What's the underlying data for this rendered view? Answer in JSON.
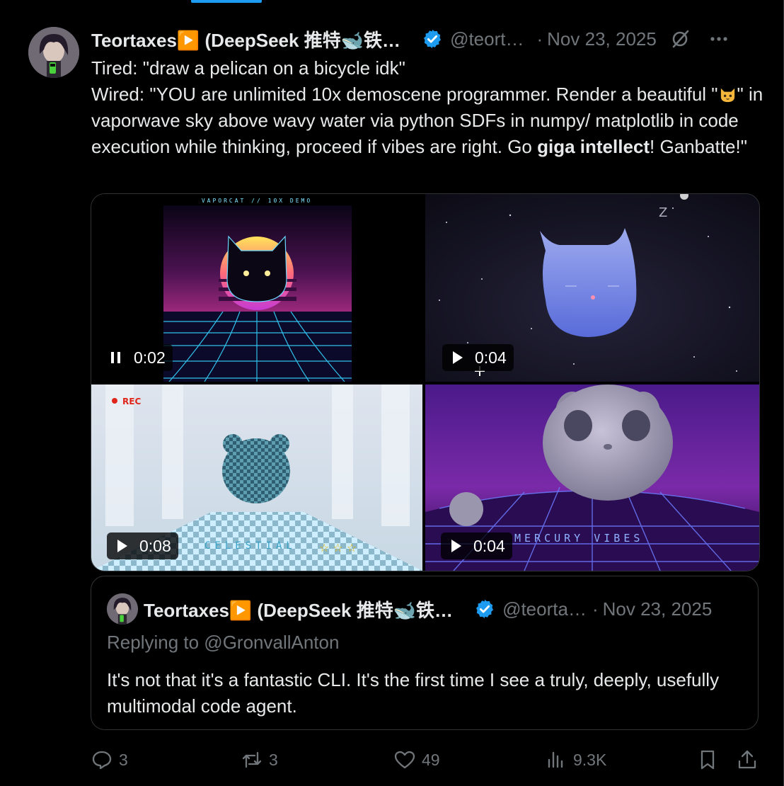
{
  "tweet": {
    "author_name": "Teortaxes▶️ (DeepSeek 推特🐋铁…",
    "handle": "@teort…",
    "separator": "·",
    "date": "Nov 23, 2025",
    "lines": {
      "tired": "Tired: \"draw a pelican on a bicycle idk\"",
      "wired_1": "Wired: \"YOU are unlimited 10x demoscene programmer. Render a beautiful \"",
      "wired_2": "\" in vaporwave sky above wavy water via python SDFs in numpy/ matplotlib in code execution while thinking, proceed if vibes are right. Go ",
      "bold": "giga intellect",
      "wired_3": "! Ganbatte!\""
    },
    "emoji": "cat-face"
  },
  "media": [
    {
      "duration": "0:02",
      "state": "pause",
      "caption": "VAPORCAT // 10X DEMO"
    },
    {
      "duration": "0:04",
      "state": "play",
      "caption": "Z"
    },
    {
      "duration": "0:08",
      "state": "play",
      "caption": "CELESTIAL",
      "rec_label": "REC",
      "stars": "☆ ☆ ☆"
    },
    {
      "duration": "0:04",
      "state": "play",
      "caption": "MERCURY VIBES"
    }
  ],
  "quote": {
    "author_name": "Teortaxes▶️ (DeepSeek 推特🐋铁…",
    "handle": "@teorta…",
    "separator": "·",
    "date": "Nov 23, 2025",
    "reply_to": "Replying to @GronvallAnton",
    "text": "It's not that it's a fantastic CLI. It's the first time I see a truly, deeply, usefully multimodal code agent."
  },
  "actions": {
    "replies": "3",
    "reposts": "3",
    "likes": "49",
    "views": "9.3K"
  },
  "colors": {
    "background": "#000000",
    "text": "#e7e9ea",
    "muted": "#71767b",
    "border": "#2f3336",
    "verified": "#1d9bf0"
  }
}
